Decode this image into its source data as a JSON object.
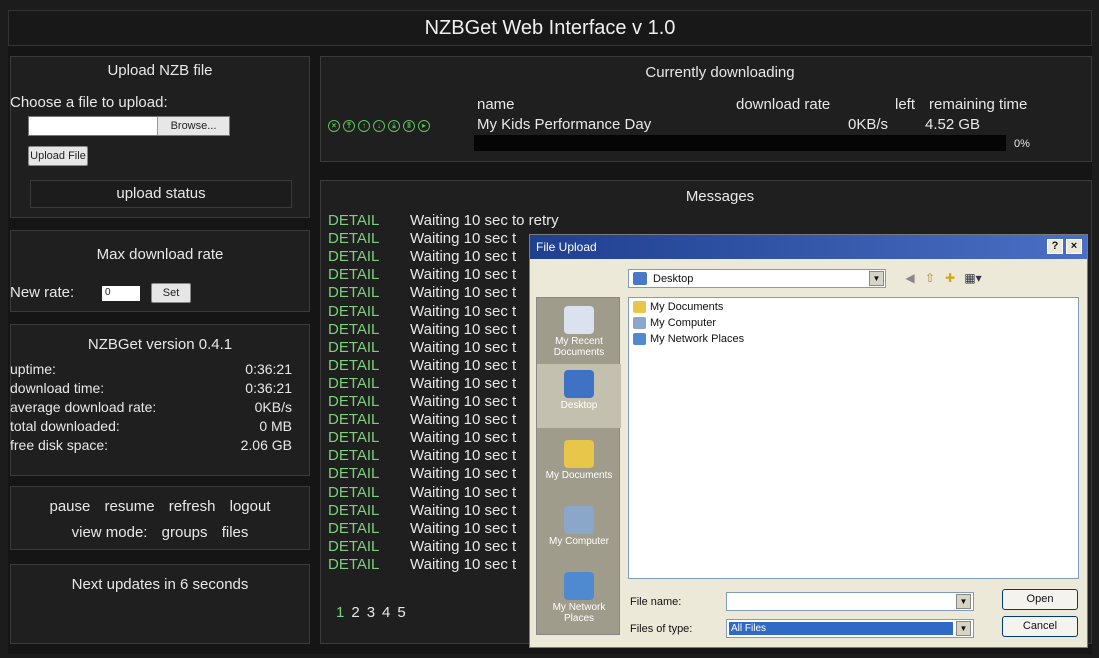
{
  "app": {
    "title": "NZBGet Web Interface v 1.0"
  },
  "upload": {
    "title": "Upload NZB file",
    "choose_label": "Choose a file to upload:",
    "browse_label": "Browse...",
    "upload_button": "Upload File",
    "status": "upload status"
  },
  "rate": {
    "title": "Max download rate",
    "new_rate_label": "New rate:",
    "value": "0",
    "set_button": "Set"
  },
  "stats": {
    "title": "NZBGet version 0.4.1",
    "rows": [
      {
        "label": "uptime:",
        "value": "0:36:21"
      },
      {
        "label": "download time:",
        "value": "0:36:21"
      },
      {
        "label": "average download rate:",
        "value": "0KB/s"
      },
      {
        "label": "total downloaded:",
        "value": "0 MB"
      },
      {
        "label": "free disk space:",
        "value": "2.06 GB"
      }
    ]
  },
  "controls": {
    "pause": "pause",
    "resume": "resume",
    "refresh": "refresh",
    "logout": "logout",
    "view_mode_label": "view mode:",
    "groups": "groups",
    "files": "files"
  },
  "next_update": "Next updates in 6 seconds",
  "downloading": {
    "title": "Currently downloading",
    "headers": {
      "name": "name",
      "rate": "download rate",
      "left": "left",
      "remaining": "remaining time"
    },
    "item": {
      "name": "My Kids Performance Day",
      "rate": "0KB/s",
      "left": "4.52 GB",
      "progress_label": "0%",
      "progress": 0
    },
    "icons": [
      "cancel-icon",
      "move-top-icon",
      "move-up-icon",
      "move-down-icon",
      "move-bottom-icon",
      "pause-icon",
      "resume-icon"
    ]
  },
  "messages": {
    "title": "Messages",
    "items": [
      {
        "level": "DETAIL",
        "text": "Waiting 10 sec to retry"
      },
      {
        "level": "DETAIL",
        "text": "Waiting 10 sec t"
      },
      {
        "level": "DETAIL",
        "text": "Waiting 10 sec t"
      },
      {
        "level": "DETAIL",
        "text": "Waiting 10 sec t"
      },
      {
        "level": "DETAIL",
        "text": "Waiting 10 sec t"
      },
      {
        "level": "DETAIL",
        "text": "Waiting 10 sec t"
      },
      {
        "level": "DETAIL",
        "text": "Waiting 10 sec t"
      },
      {
        "level": "DETAIL",
        "text": "Waiting 10 sec t"
      },
      {
        "level": "DETAIL",
        "text": "Waiting 10 sec t"
      },
      {
        "level": "DETAIL",
        "text": "Waiting 10 sec t"
      },
      {
        "level": "DETAIL",
        "text": "Waiting 10 sec t"
      },
      {
        "level": "DETAIL",
        "text": "Waiting 10 sec t"
      },
      {
        "level": "DETAIL",
        "text": "Waiting 10 sec t"
      },
      {
        "level": "DETAIL",
        "text": "Waiting 10 sec t"
      },
      {
        "level": "DETAIL",
        "text": "Waiting 10 sec t"
      },
      {
        "level": "DETAIL",
        "text": "Waiting 10 sec t"
      },
      {
        "level": "DETAIL",
        "text": "Waiting 10 sec t"
      },
      {
        "level": "DETAIL",
        "text": "Waiting 10 sec t"
      },
      {
        "level": "DETAIL",
        "text": "Waiting 10 sec t"
      },
      {
        "level": "DETAIL",
        "text": "Waiting 10 sec t"
      }
    ],
    "pages": [
      "1",
      "2",
      "3",
      "4",
      "5"
    ]
  },
  "dialog": {
    "title": "File Upload",
    "help": "?",
    "close": "×",
    "look_in": "Desktop",
    "places": [
      {
        "label": "My Recent Documents",
        "icon": "recent-documents-icon"
      },
      {
        "label": "Desktop",
        "icon": "desktop-icon"
      },
      {
        "label": "My Documents",
        "icon": "my-documents-icon"
      },
      {
        "label": "My Computer",
        "icon": "my-computer-icon"
      },
      {
        "label": "My Network Places",
        "icon": "network-places-icon"
      }
    ],
    "files": [
      "My Documents",
      "My Computer",
      "My Network Places"
    ],
    "file_name_label": "File name:",
    "file_name_value": "",
    "file_type_label": "Files of type:",
    "file_type_value": "All Files",
    "open_button": "Open",
    "cancel_button": "Cancel"
  },
  "colors": {
    "accent_green": "#7ed07e",
    "dialog_title": "#1f3f8f"
  }
}
